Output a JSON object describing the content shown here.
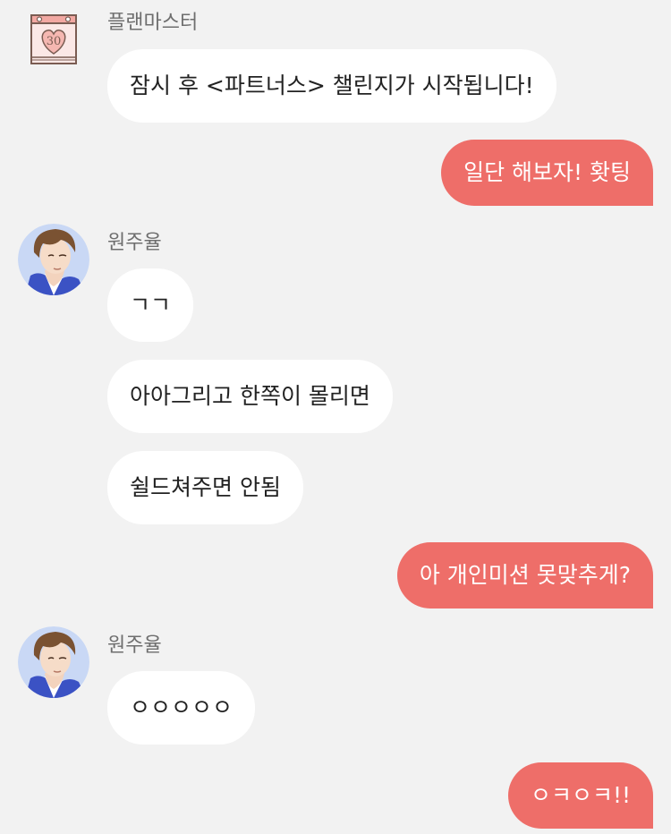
{
  "messages": [
    {
      "sender": "플랜마스터",
      "text": "잠시 후 <파트너스> 챌린지가 시작됩니다!"
    },
    {
      "text": "일단 해보자! 홧팅"
    },
    {
      "sender": "원주율",
      "text": "ㄱㄱ"
    },
    {
      "text": "아아그리고 한쪽이 몰리면"
    },
    {
      "text": "쉴드쳐주면 안됨"
    },
    {
      "text": "아 개인미션 못맞추게?"
    },
    {
      "sender": "원주율",
      "text": "ㅇㅇㅇㅇㅇ"
    },
    {
      "text": "ㅇㅋㅇㅋ!!"
    }
  ],
  "calendar_icon": {
    "number": "30",
    "icon": "heart-calendar-icon"
  },
  "colors": {
    "background": "#f2f2f2",
    "incoming": "#ffffff",
    "outgoing": "#ee6e69"
  }
}
